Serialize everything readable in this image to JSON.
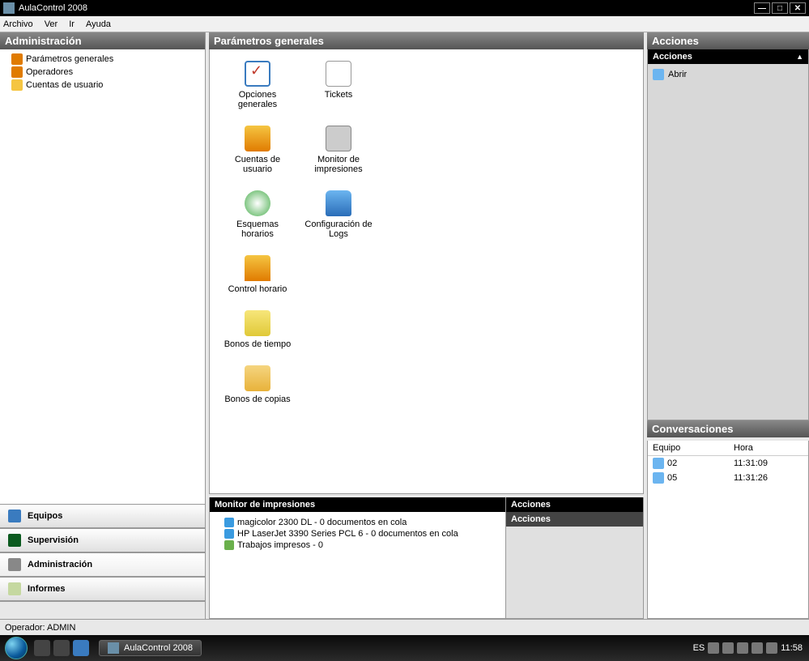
{
  "window": {
    "title": "AulaControl 2008"
  },
  "menu": {
    "archivo": "Archivo",
    "ver": "Ver",
    "ir": "Ir",
    "ayuda": "Ayuda"
  },
  "left": {
    "header": "Administración",
    "items": [
      {
        "label": "Parámetros generales"
      },
      {
        "label": "Operadores"
      },
      {
        "label": "Cuentas de usuario"
      }
    ],
    "nav": {
      "equipos": "Equipos",
      "supervision": "Supervisión",
      "administracion": "Administración",
      "informes": "Informes"
    }
  },
  "center": {
    "header": "Parámetros generales",
    "icons": {
      "opciones": "Opciones generales",
      "tickets": "Tickets",
      "cuentas": "Cuentas de usuario",
      "monitor": "Monitor de impresiones",
      "esquemas": "Esquemas horarios",
      "logs": "Configuración de Logs",
      "control": "Control horario",
      "bonos_t": "Bonos de tiempo",
      "bonos_c": "Bonos de copias"
    },
    "monitor_header": "Monitor de impresiones",
    "monitor_items": [
      "magicolor 2300 DL - 0 documentos en cola",
      "HP LaserJet 3390 Series PCL 6 - 0 documentos en cola",
      "Trabajos impresos - 0"
    ],
    "actions_header": "Acciones",
    "actions_sub": "Acciones"
  },
  "right": {
    "header": "Acciones",
    "acc_sub": "Acciones",
    "abrir": "Abrir",
    "conv_header": "Conversaciones",
    "conv_cols": {
      "equipo": "Equipo",
      "hora": "Hora"
    },
    "conv_rows": [
      {
        "equipo": "02",
        "hora": "11:31:09"
      },
      {
        "equipo": "05",
        "hora": "11:31:26"
      }
    ]
  },
  "status": {
    "operador": "Operador: ADMIN"
  },
  "taskbar": {
    "task": "AulaControl 2008",
    "lang": "ES",
    "clock": "11:58"
  }
}
